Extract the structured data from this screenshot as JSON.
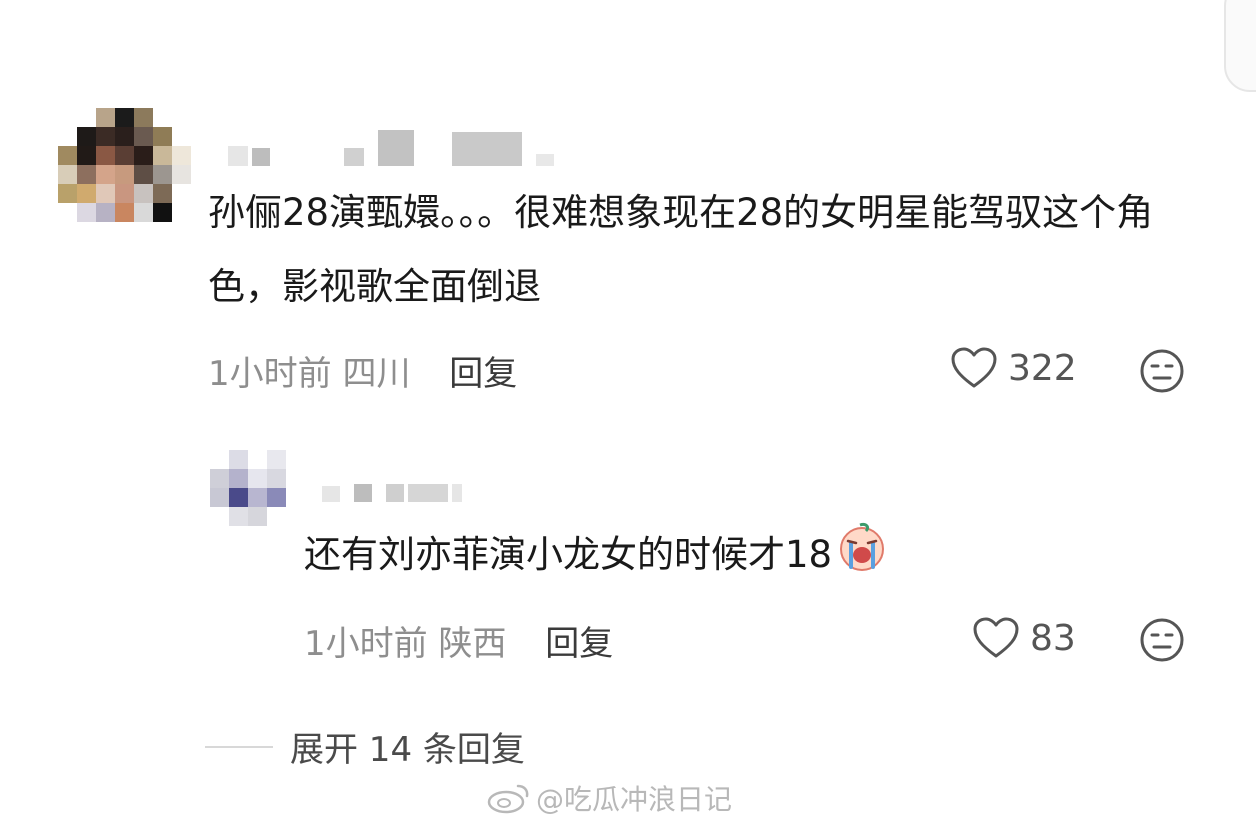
{
  "comment": {
    "text": "孙俪28演甄嬛。。。很难想象现在28的女明星能驾驭这个角色，影视歌全面倒退",
    "time": "1小时前",
    "location": "四川",
    "reply_label": "回复",
    "likes": "322",
    "like_icon": "heart-outline-icon",
    "dislike_icon": "dislike-face-icon"
  },
  "reply": {
    "text": "还有刘亦菲演小龙女的时候才18",
    "emoji": "crying-face-emoji",
    "time": "1小时前",
    "location": "陕西",
    "reply_label": "回复",
    "likes": "83"
  },
  "expand_label": "展开 14 条回复",
  "watermark": "@吃瓜冲浪日记",
  "colors": {
    "text": "#1a1a1a",
    "meta": "#8e8e8e",
    "accent": "#e05060"
  }
}
